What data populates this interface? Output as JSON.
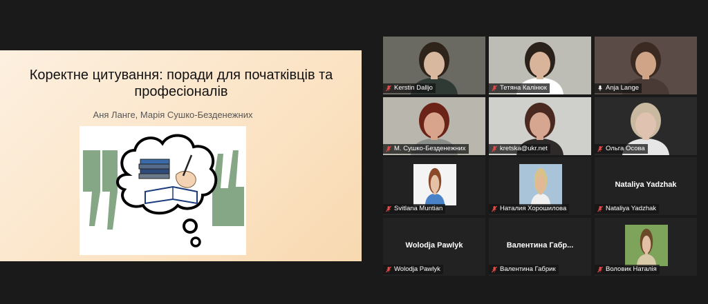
{
  "slide": {
    "title": "Коректне цитування: поради для початківців та професіоналів",
    "authors": "Аня Ланге, Марія Сушко-Безденежних"
  },
  "participants": [
    {
      "name": "Kerstin Dalljo",
      "muted": true,
      "mode": "video",
      "bg": "#6b6a62",
      "skin": "#d9b8a0",
      "hair": "#2e2419",
      "shirt": "#2f3a35"
    },
    {
      "name": "Тетяна Калінюк",
      "muted": true,
      "mode": "video",
      "bg": "#bdbdb6",
      "skin": "#d7b49a",
      "hair": "#2a211a",
      "shirt": "#ffffff"
    },
    {
      "name": "Anja Lange",
      "muted": false,
      "mode": "video",
      "active": true,
      "bg": "#5a4b46",
      "skin": "#cfa487",
      "hair": "#3a2a22",
      "shirt": "#4a3a36"
    },
    {
      "name": "М. Сушко-Безденежних",
      "muted": true,
      "mode": "video",
      "bg": "#b9b6ad",
      "skin": "#d8a48b",
      "hair": "#6b2318",
      "shirt": "#8a8f8a"
    },
    {
      "name": "kretska@ukr.net",
      "muted": true,
      "mode": "video",
      "bg": "#cfcfcc",
      "skin": "#d6a690",
      "hair": "#4a2a20",
      "shirt": "#2f2a2a"
    },
    {
      "name": "Ольга Осова",
      "muted": true,
      "mode": "video",
      "bg": "#2a2a2a",
      "skin": "#e0c2b0",
      "hair": "#c9b9a0",
      "shirt": "#e6e6e6"
    },
    {
      "name": "Svitlana Muntian",
      "muted": true,
      "mode": "avatar",
      "bg": "#f4f4f4",
      "skin": "#e5c2a6",
      "hair": "#8a4a2a",
      "shirt": "#4a82c8"
    },
    {
      "name": "Наталия Хорошилова",
      "muted": true,
      "mode": "avatar",
      "bg": "#a9c4d8",
      "skin": "#e2b895",
      "hair": "#d9c28a",
      "shirt": "#f0f0f0"
    },
    {
      "name": "Nataliya Yadzhak",
      "muted": true,
      "mode": "text",
      "display": "Nataliya Yadzhak"
    },
    {
      "name": "Wolodja Pawlyk",
      "muted": true,
      "mode": "text",
      "display": "Wolodja Pawlyk"
    },
    {
      "name": "Валентина Габрик",
      "muted": true,
      "mode": "text",
      "display": "Валентина  Габр..."
    },
    {
      "name": "Воловик Наталія",
      "muted": true,
      "mode": "avatar",
      "bg": "#7ea35a",
      "skin": "#e2bfa5",
      "hair": "#6b4a2a",
      "shirt": "#d8c9a8"
    }
  ],
  "colors": {
    "active_outline": "#b8e36b",
    "muted_icon": "#e84a4a"
  }
}
